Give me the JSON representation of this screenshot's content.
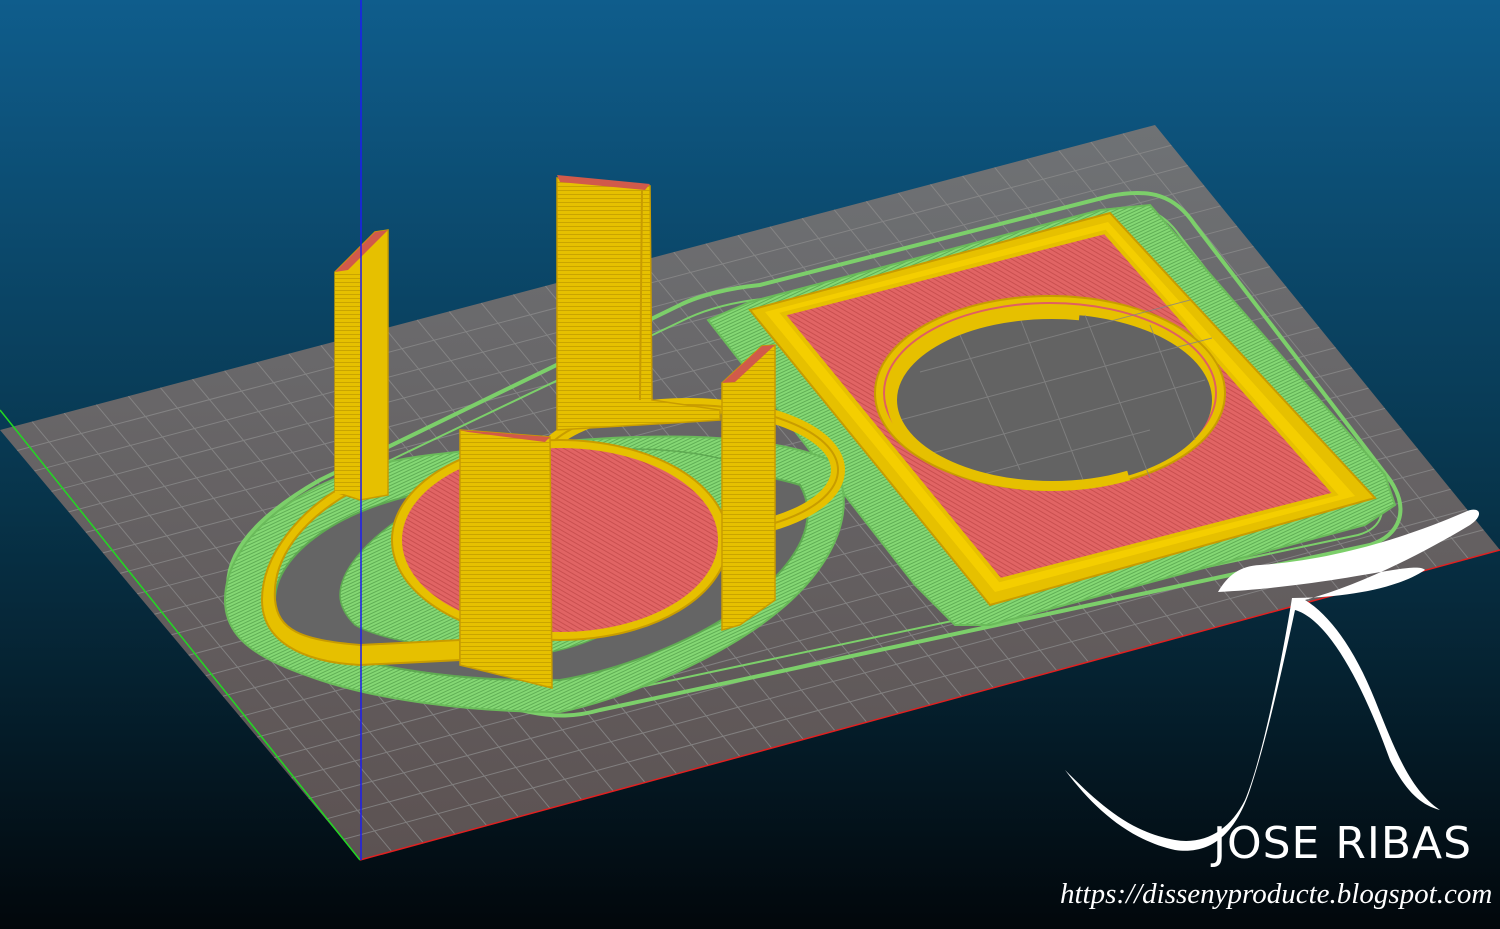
{
  "viewport": {
    "background_top": "#0f5d8c",
    "background_bottom": "#02070b",
    "bed_color": "#6b6b6b",
    "grid_color": "#8a8a8a",
    "axis_z_color": "#1c1cf0",
    "axis_x_color": "#e02020",
    "axis_y_color": "#22d822"
  },
  "toolpath_colors": {
    "perimeter": "#e6c000",
    "infill": "#e06060",
    "skirt_support": "#7ccf6a"
  },
  "watermark": {
    "author": "JOSE RIBAS",
    "url": "https://dissenyproducte.blogspot.com",
    "logo_icon": "r-swoosh-logo-icon"
  }
}
